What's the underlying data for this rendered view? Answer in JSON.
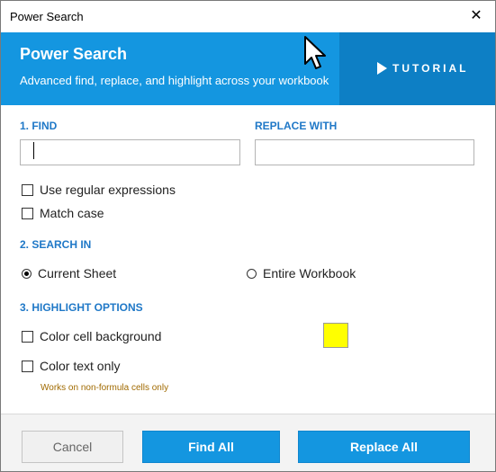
{
  "window": {
    "title": "Power Search",
    "close_glyph": "✕"
  },
  "banner": {
    "title": "Power Search",
    "subtitle": "Advanced find, replace, and highlight across your workbook",
    "tutorial_label": "TUTORIAL",
    "colors": {
      "banner": "#1496e0",
      "tutorial_panel": "#0d7fc5"
    }
  },
  "find": {
    "label": "1. FIND",
    "value": ""
  },
  "replace": {
    "label": "REPLACE WITH",
    "value": ""
  },
  "options": {
    "regex": {
      "label": "Use regular expressions",
      "checked": false
    },
    "match_case": {
      "label": "Match case",
      "checked": false
    }
  },
  "search_in": {
    "label": "2. SEARCH IN",
    "current_sheet": {
      "label": "Current Sheet",
      "selected": true
    },
    "entire_workbook": {
      "label": "Entire Workbook",
      "selected": false
    }
  },
  "highlight": {
    "label": "3. HIGHLIGHT OPTIONS",
    "color_background": {
      "label": "Color cell background",
      "checked": false
    },
    "color_text": {
      "label": "Color text only",
      "checked": false
    },
    "note": "Works on non-formula cells only",
    "swatch_color": "#ffff00"
  },
  "footer": {
    "cancel_label": "Cancel",
    "find_all_label": "Find All",
    "replace_all_label": "Replace All"
  }
}
